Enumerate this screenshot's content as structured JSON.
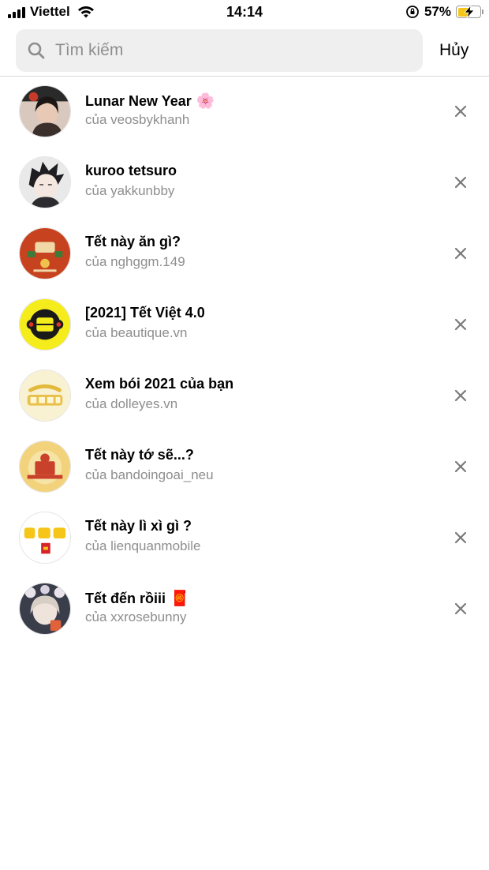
{
  "status_bar": {
    "carrier": "Viettel",
    "time": "14:14",
    "battery_percent": "57%",
    "battery_level": 0.57
  },
  "search": {
    "placeholder": "Tìm kiếm",
    "cancel_label": "Hủy"
  },
  "results": [
    {
      "title": "Lunar New Year",
      "emoji": "🌸",
      "subtitle": "của veosbykhanh"
    },
    {
      "title": "kuroo tetsuro",
      "emoji": "",
      "subtitle": "của yakkunbby"
    },
    {
      "title": "Tết này ăn gì?",
      "emoji": "",
      "subtitle": "của nghggm.149"
    },
    {
      "title": "[2021] Tết Việt 4.0",
      "emoji": "",
      "subtitle": "của beautique.vn"
    },
    {
      "title": "Xem bói 2021 của bạn",
      "emoji": "",
      "subtitle": "của dolleyes.vn"
    },
    {
      "title": "Tết này tớ sẽ...?",
      "emoji": "",
      "subtitle": "của bandoingoai_neu"
    },
    {
      "title": "Tết này lì xì gì ?",
      "emoji": "",
      "subtitle": "của lienquanmobile"
    },
    {
      "title": "Tết đến rồiii",
      "emoji": "🧧",
      "subtitle": "của xxrosebunny"
    }
  ],
  "icons": {
    "search": "search-icon",
    "remove": "close-icon",
    "wifi": "wifi-icon",
    "orientation_lock": "orientation-lock-icon",
    "battery": "battery-icon"
  }
}
